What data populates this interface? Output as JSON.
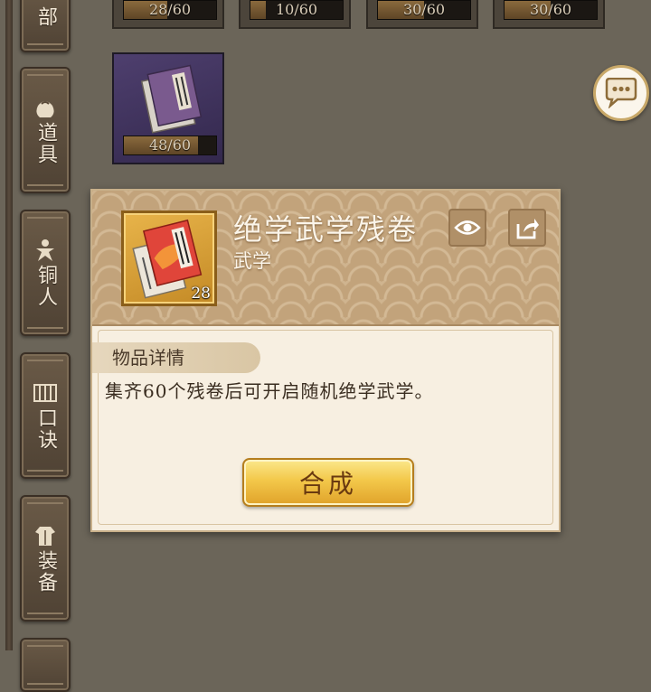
{
  "sidebar": {
    "tabs": [
      {
        "label": "部",
        "icon": "scroll-icon"
      },
      {
        "label": "道具",
        "icon": "bag-icon"
      },
      {
        "label": "铜人",
        "icon": "bronze-figure-icon"
      },
      {
        "label": "口诀",
        "icon": "bamboo-scroll-icon"
      },
      {
        "label": "装备",
        "icon": "armor-icon"
      }
    ]
  },
  "grid": {
    "top_row": [
      {
        "progress_text": "28/60",
        "progress": 0.4667
      },
      {
        "progress_text": "10/60",
        "progress": 0.1667
      },
      {
        "progress_text": "30/60",
        "progress": 0.5
      },
      {
        "progress_text": "30/60",
        "progress": 0.5
      }
    ],
    "second_row": [
      {
        "progress_text": "48/60",
        "progress": 0.8,
        "rarity_color": "#4e3f6e"
      }
    ]
  },
  "chat": {
    "icon": "chat-bubble-icon"
  },
  "popup": {
    "item_name": "绝学武学残卷",
    "item_type": "武学",
    "item_count": "28",
    "view_icon": "eye-icon",
    "share_icon": "share-icon",
    "section_title": "物品详情",
    "description": "集齐60个残卷后可开启随机绝学武学。",
    "compose_label": "合成"
  },
  "colors": {
    "accent_gold": "#f3c84a",
    "header_tan": "#c2a37b",
    "backdrop": "#6b6559"
  }
}
